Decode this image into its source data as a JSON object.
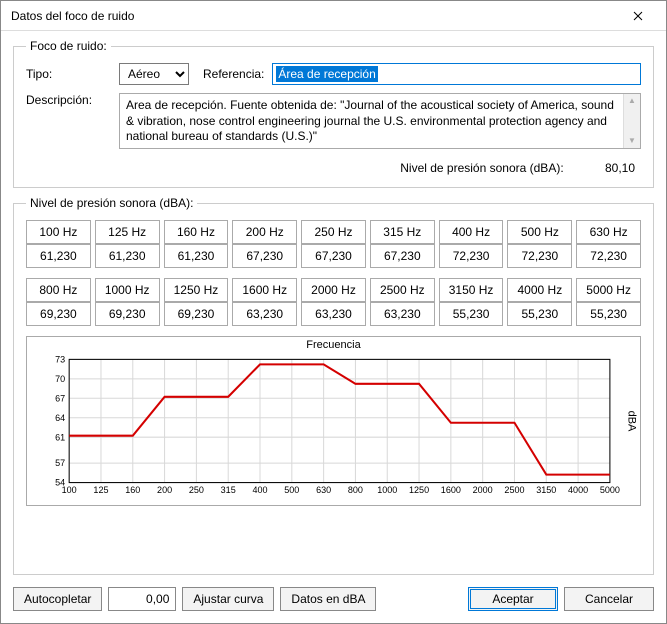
{
  "window": {
    "title": "Datos del foco de ruido"
  },
  "foco": {
    "legend": "Foco de ruido:",
    "tipo_label": "Tipo:",
    "tipo_value": "Aéreo",
    "ref_label": "Referencia:",
    "ref_value": "Área de recepción",
    "desc_label": "Descripción:",
    "desc_value": "Area de recepción. Fuente obtenida de: \"Journal of the acoustical society of America, sound & vibration, nose control engineering journal the U.S. environmental protection agency and national bureau of standards (U.S.)\"",
    "nps_label": "Nivel de presión sonora (dBA):",
    "nps_value": "80,10"
  },
  "nivel": {
    "legend": "Nivel de presión sonora (dBA):",
    "row1_headers": [
      "100 Hz",
      "125 Hz",
      "160 Hz",
      "200 Hz",
      "250 Hz",
      "315 Hz",
      "400 Hz",
      "500 Hz",
      "630 Hz"
    ],
    "row1_values": [
      "61,230",
      "61,230",
      "61,230",
      "67,230",
      "67,230",
      "67,230",
      "72,230",
      "72,230",
      "72,230"
    ],
    "row2_headers": [
      "800 Hz",
      "1000 Hz",
      "1250 Hz",
      "1600 Hz",
      "2000 Hz",
      "2500 Hz",
      "3150 Hz",
      "4000 Hz",
      "5000 Hz"
    ],
    "row2_values": [
      "69,230",
      "69,230",
      "69,230",
      "63,230",
      "63,230",
      "63,230",
      "55,230",
      "55,230",
      "55,230"
    ]
  },
  "chart_data": {
    "type": "line",
    "title": "Frecuencia",
    "ylabel": "dBA",
    "xlabel": "",
    "categories": [
      "100",
      "125",
      "160",
      "200",
      "250",
      "315",
      "400",
      "500",
      "630",
      "800",
      "1000",
      "1250",
      "1600",
      "2000",
      "2500",
      "3150",
      "4000",
      "5000"
    ],
    "values": [
      61.23,
      61.23,
      61.23,
      67.23,
      67.23,
      67.23,
      72.23,
      72.23,
      72.23,
      69.23,
      69.23,
      69.23,
      63.23,
      63.23,
      63.23,
      55.23,
      55.23,
      55.23
    ],
    "ylim": [
      54,
      73
    ],
    "yticks": [
      54,
      57,
      61,
      64,
      67,
      70,
      73
    ]
  },
  "buttons": {
    "autocompletar": "Autocopletar",
    "num_value": "0,00",
    "ajustar": "Ajustar curva",
    "datos": "Datos en dBA",
    "aceptar": "Aceptar",
    "cancelar": "Cancelar"
  }
}
